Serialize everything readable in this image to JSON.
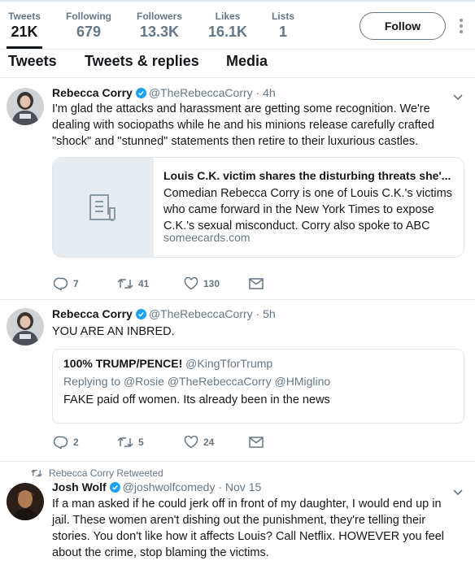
{
  "stats": [
    {
      "label": "Tweets",
      "value": "21K"
    },
    {
      "label": "Following",
      "value": "679"
    },
    {
      "label": "Followers",
      "value": "13.3K"
    },
    {
      "label": "Likes",
      "value": "16.1K"
    },
    {
      "label": "Lists",
      "value": "1"
    }
  ],
  "follow_label": "Follow",
  "tabs": [
    "Tweets",
    "Tweets & replies",
    "Media"
  ],
  "tweets": [
    {
      "name": "Rebecca Corry",
      "handle": "@TheRebeccaCorry",
      "sep": "·",
      "time": "4h",
      "text": "I'm glad the attacks and harassment are getting some recognition. We're dealing with sociopaths while he and his minions release carefully crafted \"shock\" and \"stunned\" statements then retire to their luxurious castles.",
      "card": {
        "title": "Louis C.K. victim shares the disturbing threats she'...",
        "description": "Comedian Rebecca Corry is one of Louis C.K.'s victims who came forward in the New York Times to expose C.K.'s sexual misconduct. Corry also spoke to ABC",
        "domain": "someecards.com"
      },
      "replies": "7",
      "retweets": "41",
      "likes": "130"
    },
    {
      "name": "Rebecca Corry",
      "handle": "@TheRebeccaCorry",
      "sep": "·",
      "time": "5h",
      "text": "YOU ARE AN INBRED.",
      "quote": {
        "name": "100% TRUMP/PENCE!",
        "handle": "@KingTforTrump",
        "replying_prefix": "Replying to",
        "replying_to": "@Rosie @TheRebeccaCorry @HMiglino",
        "text": "FAKE paid off women. Its already been in the news"
      },
      "replies": "2",
      "retweets": "5",
      "likes": "24"
    },
    {
      "retweeted_by": "Rebecca Corry Retweeted",
      "name": "Josh Wolf",
      "handle": "@joshwolfcomedy",
      "sep": "·",
      "time": "Nov 15",
      "text": "If a man asked if he could jerk off in front of my daughter, I would end up in jail. These women aren't dishing out the punishment, they're telling their stories. You don't like how it affects Louis? Call Netflix. HOWEVER you feel about the crime, stop blaming the victims."
    }
  ],
  "colors": {
    "text": "#14171a",
    "secondary": "#657786",
    "verified": "#1da1f2",
    "border": "#e6ecf0"
  }
}
